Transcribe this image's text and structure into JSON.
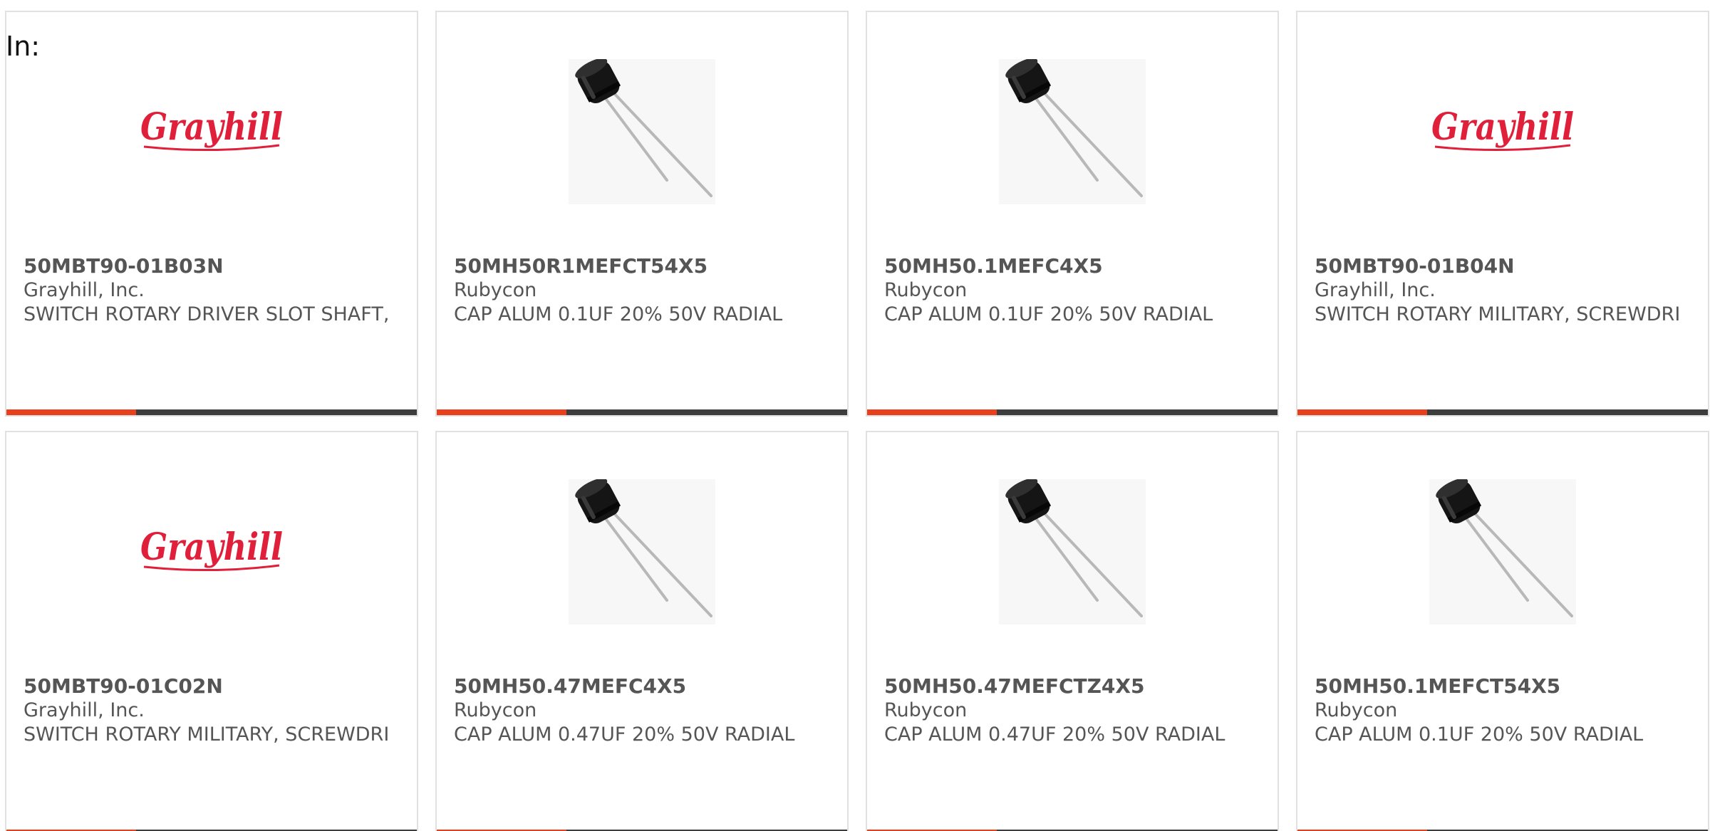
{
  "header": {
    "label": "In:"
  },
  "accent_color": "#e8401c",
  "bar_color": "#3d3d3d",
  "products": [
    {
      "part_number": "50MBT90-01B03N",
      "manufacturer": "Grayhill, Inc.",
      "description": "SWITCH ROTARY DRIVER SLOT SHAFT,",
      "image": "grayhill-logo",
      "logo_text": "Grayhill"
    },
    {
      "part_number": "50MH50R1MEFCT54X5",
      "manufacturer": "Rubycon",
      "description": "CAP ALUM 0.1UF 20% 50V RADIAL",
      "image": "capacitor-photo"
    },
    {
      "part_number": "50MH50.1MEFC4X5",
      "manufacturer": "Rubycon",
      "description": "CAP ALUM 0.1UF 20% 50V RADIAL",
      "image": "capacitor-photo"
    },
    {
      "part_number": "50MBT90-01B04N",
      "manufacturer": "Grayhill, Inc.",
      "description": "SWITCH ROTARY MILITARY, SCREWDRI",
      "image": "grayhill-logo",
      "logo_text": "Grayhill"
    },
    {
      "part_number": "50MBT90-01C02N",
      "manufacturer": "Grayhill, Inc.",
      "description": "SWITCH ROTARY MILITARY, SCREWDRI",
      "image": "grayhill-logo",
      "logo_text": "Grayhill"
    },
    {
      "part_number": "50MH50.47MEFC4X5",
      "manufacturer": "Rubycon",
      "description": "CAP ALUM 0.47UF 20% 50V RADIAL",
      "image": "capacitor-photo"
    },
    {
      "part_number": "50MH50.47MEFCTZ4X5",
      "manufacturer": "Rubycon",
      "description": "CAP ALUM 0.47UF 20% 50V RADIAL",
      "image": "capacitor-photo"
    },
    {
      "part_number": "50MH50.1MEFCT54X5",
      "manufacturer": "Rubycon",
      "description": "CAP ALUM 0.1UF 20% 50V RADIAL",
      "image": "capacitor-photo"
    }
  ]
}
